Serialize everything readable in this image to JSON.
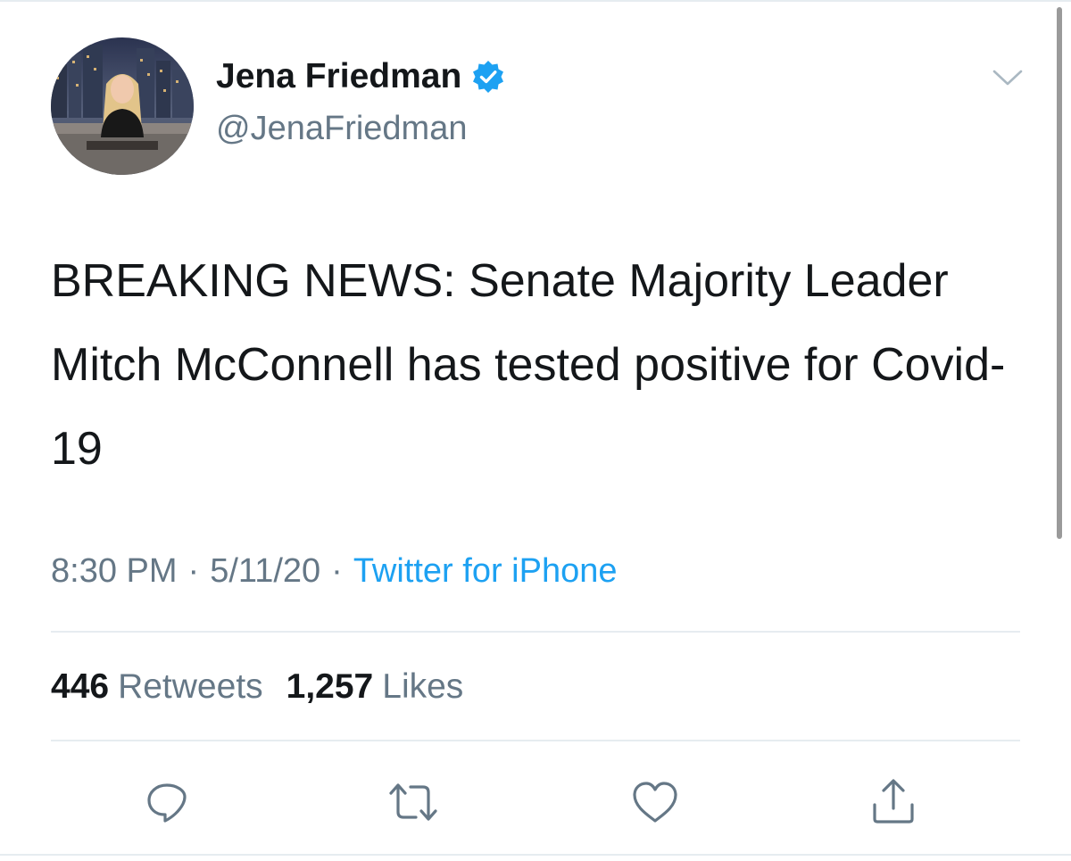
{
  "tweet": {
    "author": {
      "display_name": "Jena Friedman",
      "handle": "@JenaFriedman",
      "verified_icon": "verified-badge-icon"
    },
    "text": "BREAKING NEWS: Senate Majority Leader Mitch McConnell has tested positive for Covid-19",
    "time": "8:30 PM",
    "date": "5/11/20",
    "separator": "·",
    "source": "Twitter for iPhone",
    "stats": {
      "retweets_count": "446",
      "retweets_label": "Retweets",
      "likes_count": "1,257",
      "likes_label": "Likes"
    },
    "actions": [
      "reply-icon",
      "retweet-icon",
      "like-icon",
      "share-icon"
    ]
  },
  "colors": {
    "text_primary": "#14171a",
    "text_secondary": "#657786",
    "link_blue": "#1da1f2",
    "divider": "#e6ecf0"
  }
}
